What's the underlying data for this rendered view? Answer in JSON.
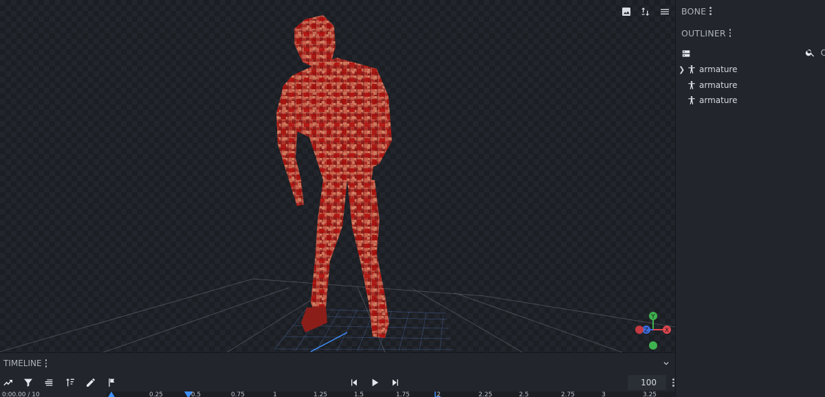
{
  "viewport": {
    "toolbar": {
      "screenshot_icon": "image-icon",
      "transform_icon": "swap-vertical-icon",
      "menu_icon": "menu-icon"
    },
    "gizmo": {
      "y": "Y",
      "z": "Z",
      "x": "X",
      "colors": {
        "x": "#e0474f",
        "y": "#3fb24f",
        "z": "#3c6ce0"
      }
    }
  },
  "side_panel": {
    "bone": {
      "title": "BONE"
    },
    "outliner": {
      "title": "OUTLINER",
      "tools": {
        "add_icon": "server-icon",
        "search_icon": "search-icon",
        "overflow_char": "C"
      },
      "items": [
        {
          "label": "armature",
          "expandable": true
        },
        {
          "label": "armature",
          "expandable": false
        },
        {
          "label": "armature",
          "expandable": false
        }
      ]
    }
  },
  "timeline": {
    "title": "TIMELINE",
    "frame_value": "100",
    "tools": [
      "graph-icon",
      "filter-icon",
      "list-icon",
      "sort-icon",
      "pencil-icon",
      "flag-icon"
    ],
    "playback": [
      "skip-back-icon",
      "play-icon",
      "skip-forward-icon"
    ],
    "ruler": {
      "time_prefix": "0:00.00 / 10",
      "ticks": [
        "0.25",
        "0.5",
        "0.75",
        "1",
        "1.25",
        "1.5",
        "1.75",
        "2",
        "2.25",
        "2.5",
        "2.75",
        "3",
        "3.25"
      ]
    },
    "colors": {
      "accent": "#3e90ff"
    }
  }
}
